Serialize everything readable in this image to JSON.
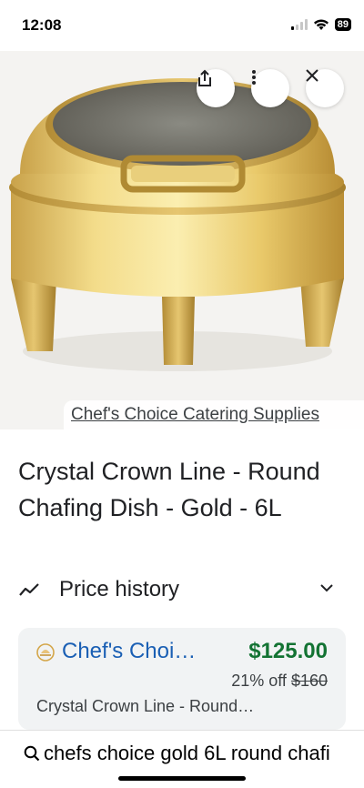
{
  "status_bar": {
    "time": "12:08",
    "battery": "89"
  },
  "hero": {
    "source_link": "Chef's Choice Catering Supplies",
    "buttons": {
      "share": "share-icon",
      "more": "more-vert-icon",
      "close": "close-icon"
    }
  },
  "product": {
    "title": "Crystal Crown Line - Round Chafing Dish - Gold - 6L"
  },
  "price_history": {
    "label": "Price history"
  },
  "offer": {
    "merchant": "Chef's Choi…",
    "price": "$125.00",
    "discount": "21% off",
    "original_price": "$160",
    "description": "Crystal Crown Line - Round…"
  },
  "search": {
    "query": "chefs choice gold 6L round chafi"
  },
  "colors": {
    "link_blue": "#1a5fb4",
    "price_green": "#137333",
    "card_bg": "#f1f3f4"
  }
}
